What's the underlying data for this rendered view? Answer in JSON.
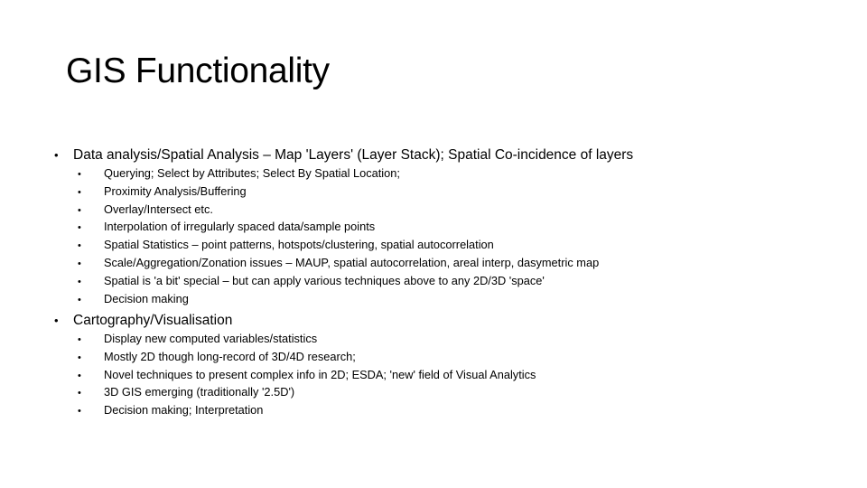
{
  "slide": {
    "title": "GIS Functionality",
    "bullet_glyph": "•",
    "sections": [
      {
        "heading": "Data analysis/Spatial Analysis – Map 'Layers' (Layer Stack); Spatial Co-incidence of layers",
        "items": [
          "Querying; Select by Attributes; Select By Spatial Location;",
          "Proximity Analysis/Buffering",
          "Overlay/Intersect etc.",
          "Interpolation of irregularly spaced data/sample points",
          "Spatial Statistics – point patterns, hotspots/clustering, spatial autocorrelation",
          "Scale/Aggregation/Zonation issues – MAUP, spatial autocorrelation, areal interp, dasymetric map",
          "Spatial is 'a bit' special – but can apply various techniques above to any 2D/3D 'space'",
          "Decision making"
        ]
      },
      {
        "heading": "Cartography/Visualisation",
        "items": [
          "Display new computed variables/statistics",
          "Mostly 2D though long-record of 3D/4D research;",
          "Novel techniques to present complex info in 2D; ESDA; 'new' field of Visual Analytics",
          "3D GIS emerging (traditionally '2.5D')",
          "Decision making; Interpretation"
        ]
      }
    ]
  },
  "colors": {
    "background": "#ffffff",
    "text": "#000000"
  }
}
